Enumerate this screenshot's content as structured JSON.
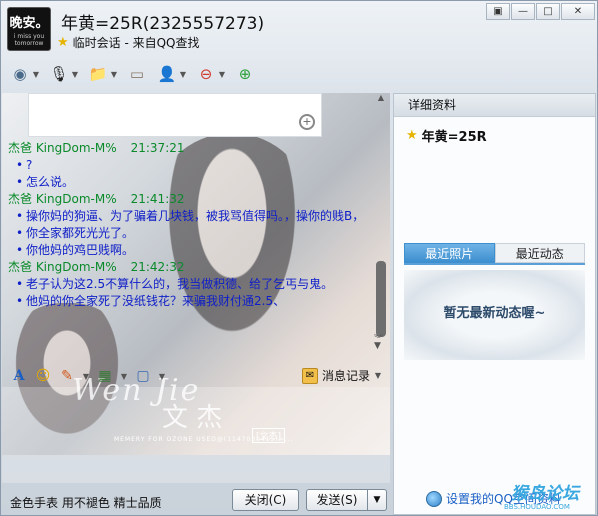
{
  "window": {
    "title": "年黄=25R(2325557273)",
    "subtitle": "临时会话 - 来自QQ查找",
    "avatar_text": "晚安。",
    "avatar_sub": "i miss you tomorrow",
    "controls": [
      "▣",
      "—",
      "□",
      "✕"
    ]
  },
  "toolbar": {
    "items": [
      {
        "icon": "video-icon",
        "glyph": "◉"
      },
      {
        "icon": "microphone-icon",
        "glyph": "🎙"
      },
      {
        "icon": "folder-transfer-icon",
        "glyph": "📁"
      },
      {
        "icon": "screen-icon",
        "glyph": "▭"
      },
      {
        "icon": "user-info-icon",
        "glyph": "👤"
      },
      {
        "icon": "block-user-icon",
        "glyph": "⊖"
      },
      {
        "icon": "add-friend-icon",
        "glyph": "⊕"
      }
    ]
  },
  "chat": {
    "messages": [
      {
        "sender": "杰爸  KingDom-M%",
        "time": "21:37:21",
        "lines": [
          "?",
          "怎么说。"
        ]
      },
      {
        "sender": "杰爸  KingDom-M%",
        "time": "21:41:32",
        "lines": [
          "操你妈的狗逼、为了骗着几块钱，被我骂值得吗。，操你的贱B，",
          "你全家都死光光了。",
          "你他妈的鸡巴贱啊。"
        ]
      },
      {
        "sender": "杰爸  KingDom-M%",
        "time": "21:42:32",
        "lines": [
          "老子认为这2.5不算什么的，我当做积德、给了乞丐与鬼。",
          "他妈的你全家死了没纸钱花？来骗我财付通2.5、"
        ]
      }
    ],
    "watermark_main": "Wen Jie",
    "watermark_sub": "MEMERY FOR OZONE USED@(1147030415)>...",
    "watermark_tag": "[文杰]",
    "watermark_cn": "文 杰"
  },
  "input_toolbar": {
    "history_label": "消息记录"
  },
  "bottom": {
    "ad_text": "金色手表 用不褪色 精士品质",
    "close_label": "关闭(C)",
    "send_label": "发送(S)",
    "send_dropdown": "▼"
  },
  "panel": {
    "header": "详细资料",
    "name": "年黄=25R",
    "tabs": [
      "最近照片",
      "最近动态"
    ],
    "active_tab": 0,
    "empty_text": "暂无最新动态喔~",
    "footer_link": "设置我的QQ空间资料",
    "bbs_logo": "猴岛论坛",
    "bbs_url": "BBS.HOUDAO.COM"
  },
  "colors": {
    "sender": "#0a8a2a",
    "message": "#1020c8",
    "tab_active": "#3d8fcf"
  }
}
